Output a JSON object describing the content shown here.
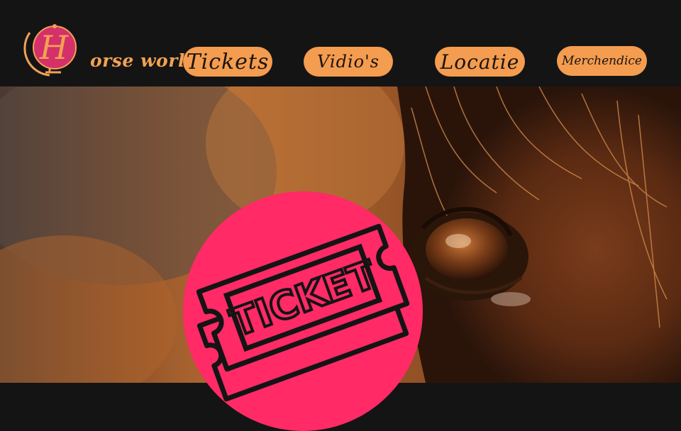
{
  "logo": {
    "text": "orse world",
    "monogram": "H",
    "icon": "globe-icon"
  },
  "nav": {
    "tickets": "Tickets",
    "videos": "Vidio's",
    "locatie": "Locatie",
    "merchandice": "Merchendice"
  },
  "hero": {
    "image": "horse-eye-closeup"
  },
  "ticket_badge": {
    "icon": "ticket-icon",
    "text": "TICKET",
    "color": "#ff2a66"
  },
  "colors": {
    "header_bg": "#141414",
    "nav_button": "#f49c4f",
    "logo_accent": "#f0a254",
    "logo_globe": "#d4306a"
  }
}
